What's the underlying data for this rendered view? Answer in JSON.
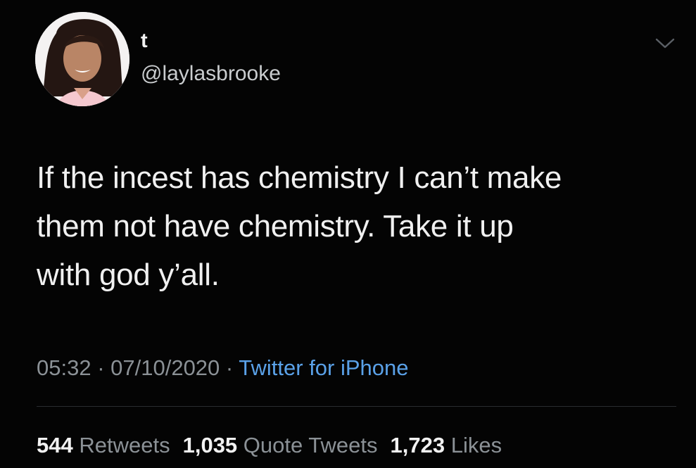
{
  "author": {
    "display_name": "t",
    "handle": "@laylasbrooke"
  },
  "tweet": {
    "text": "If the incest has chemistry I can’t make\nthem not have chemistry. Take it up\nwith god y’all."
  },
  "meta": {
    "time": "05:32",
    "separator": " · ",
    "date": "07/10/2020",
    "source": "Twitter for iPhone"
  },
  "stats": {
    "retweets_count": "544",
    "retweets_label": "Retweets",
    "quotes_count": "1,035",
    "quotes_label": "Quote Tweets",
    "likes_count": "1,723",
    "likes_label": "Likes"
  },
  "icons": {
    "menu": "chevron-down-icon"
  },
  "colors": {
    "background": "#000000",
    "text": "#f0f0f0",
    "secondary": "#8b9196",
    "link": "#5aa1e8"
  }
}
